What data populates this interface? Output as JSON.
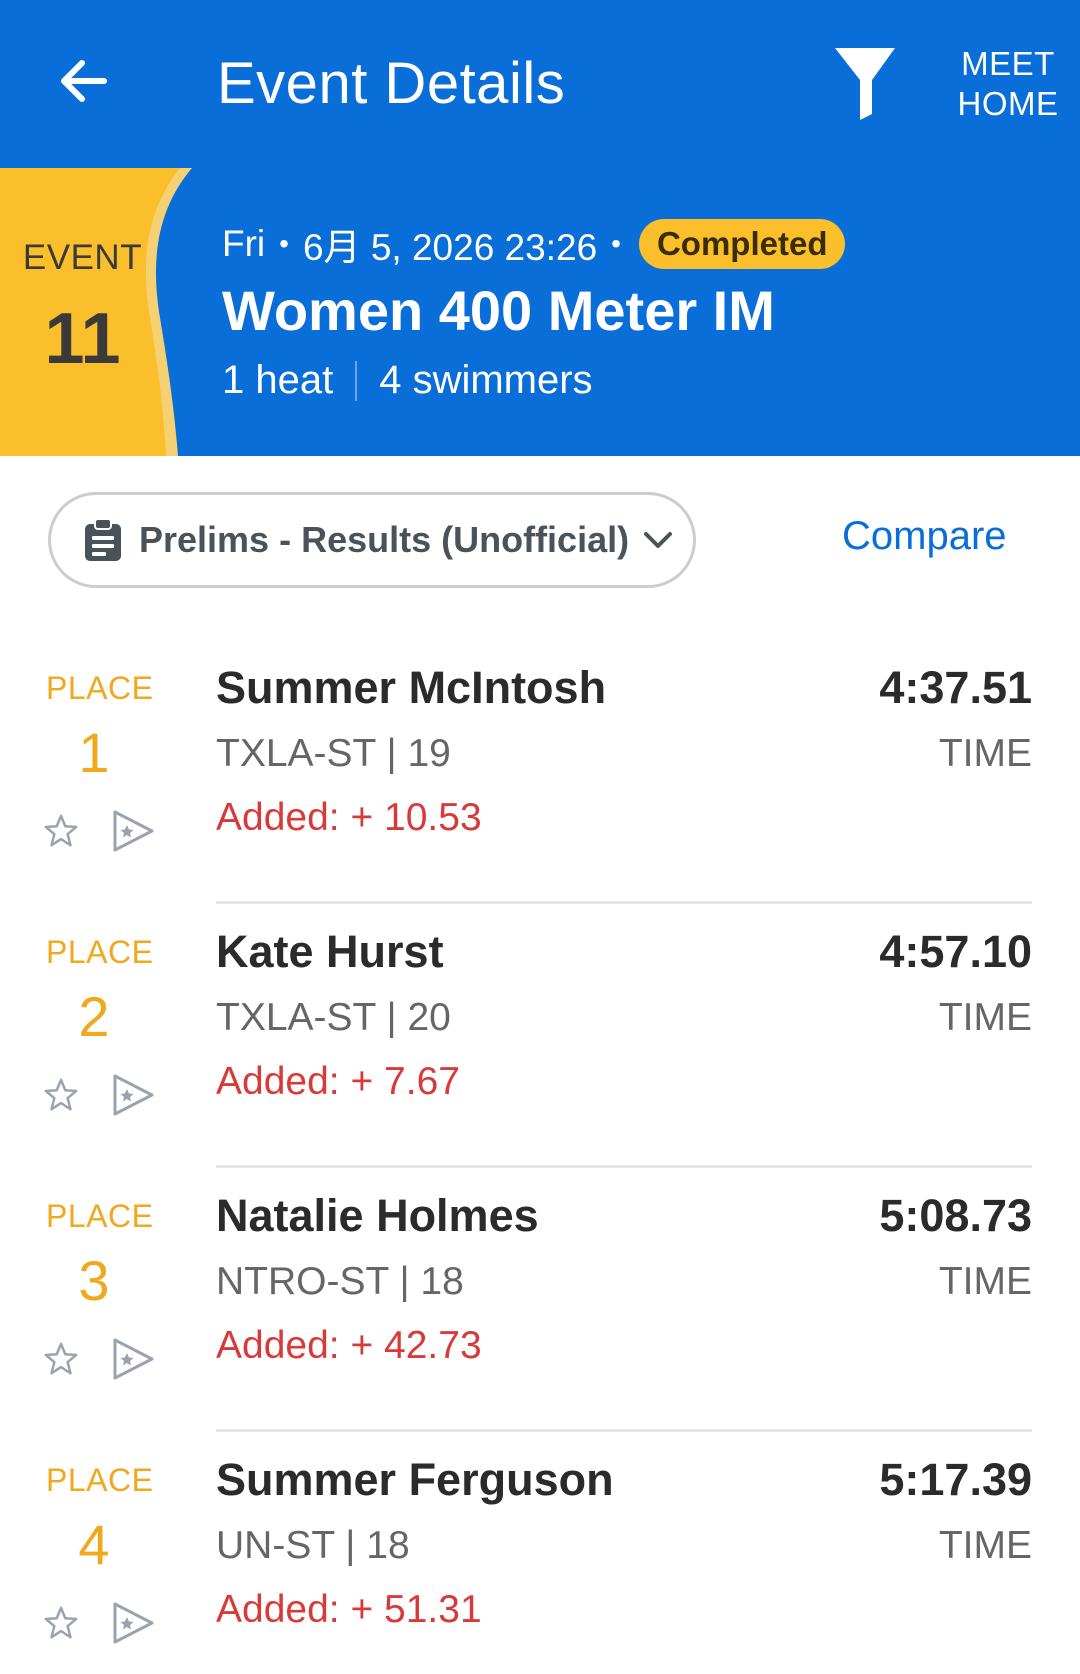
{
  "header": {
    "title": "Event Details",
    "meet_home_line1": "MEET",
    "meet_home_line2": "HOME"
  },
  "event": {
    "label": "EVENT",
    "number": "11",
    "day": "Fri",
    "datetime": "6月 5, 2026 23:26",
    "status": "Completed",
    "title": "Women 400 Meter IM",
    "heats": "1 heat",
    "swimmers": "4 swimmers"
  },
  "controls": {
    "round_select": "Prelims - Results (Unofficial)",
    "compare": "Compare"
  },
  "results": [
    {
      "place_label": "PLACE",
      "place": "1",
      "name": "Summer McIntosh",
      "team_age": "TXLA-ST | 19",
      "added": "Added: + 10.53",
      "time": "4:37.51",
      "time_label": "TIME"
    },
    {
      "place_label": "PLACE",
      "place": "2",
      "name": "Kate Hurst",
      "team_age": "TXLA-ST | 20",
      "added": "Added: + 7.67",
      "time": "4:57.10",
      "time_label": "TIME"
    },
    {
      "place_label": "PLACE",
      "place": "3",
      "name": "Natalie Holmes",
      "team_age": "NTRO-ST | 18",
      "added": "Added: + 42.73",
      "time": "5:08.73",
      "time_label": "TIME"
    },
    {
      "place_label": "PLACE",
      "place": "4",
      "name": "Summer Ferguson",
      "team_age": "UN-ST | 18",
      "added": "Added: + 51.31",
      "time": "5:17.39",
      "time_label": "TIME"
    }
  ],
  "icons": [
    "back-arrow-icon",
    "filter-icon",
    "clipboard-icon",
    "chevron-down-icon",
    "star-outline-icon",
    "share-flag-icon"
  ],
  "colors": {
    "primary": "#0a6ed8",
    "accent": "#fbbf2c",
    "place": "#f0a81e",
    "added": "#d83a3a"
  }
}
